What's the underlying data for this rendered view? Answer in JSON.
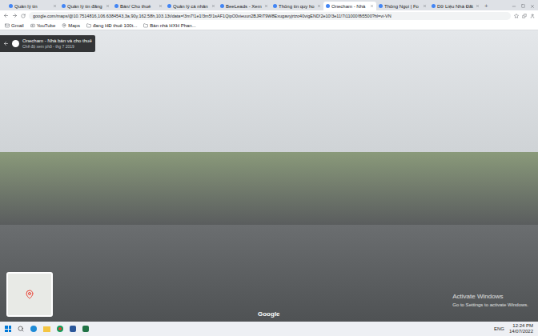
{
  "browser": {
    "tabs": [
      {
        "label": "Quản lý tin",
        "selected": false
      },
      {
        "label": "Quản lý tin đăng",
        "selected": false
      },
      {
        "label": "Bán/ Cho thuê",
        "selected": false
      },
      {
        "label": "Quản lý cá nhân",
        "selected": false
      },
      {
        "label": "BeeLeads - Xem",
        "selected": false
      },
      {
        "label": "Thông tin quy ho",
        "selected": false
      },
      {
        "label": "Onecham - Nhà",
        "selected": true
      },
      {
        "label": "Thông Ngọi | Fo",
        "selected": false
      },
      {
        "label": "Dữ Liệu Nhà Đất",
        "selected": false
      }
    ],
    "new_tab": "+",
    "address": "google.com/maps/@10.7514816,106.6384543,3a,90y,162.58h,103.13t/data=!3m7!1e1!3m5!1sAF1QipO0vieuun2BJRiT9W8Exugavyjrtzo40vigEND!2e10!3e11!7i11000!8i5500?hl=vi-VN",
    "bookmarks": [
      "Gmail",
      "YouTube",
      "Maps",
      "đang HĐ thuê 100t...",
      "Bàn nhà HXH Phan..."
    ]
  },
  "street_view": {
    "title": "Onecham - Nhà bán và cho thuê",
    "subtitle": "Chế độ xem phố - thg 7 2019",
    "logo": "Google"
  },
  "watermark": {
    "lines": [
      "Activate Windows",
      "Go to Settings to activate Windows."
    ]
  },
  "taskbar": {
    "language": "ENG",
    "time": "12:24 PM",
    "date": "14/07/2022"
  }
}
